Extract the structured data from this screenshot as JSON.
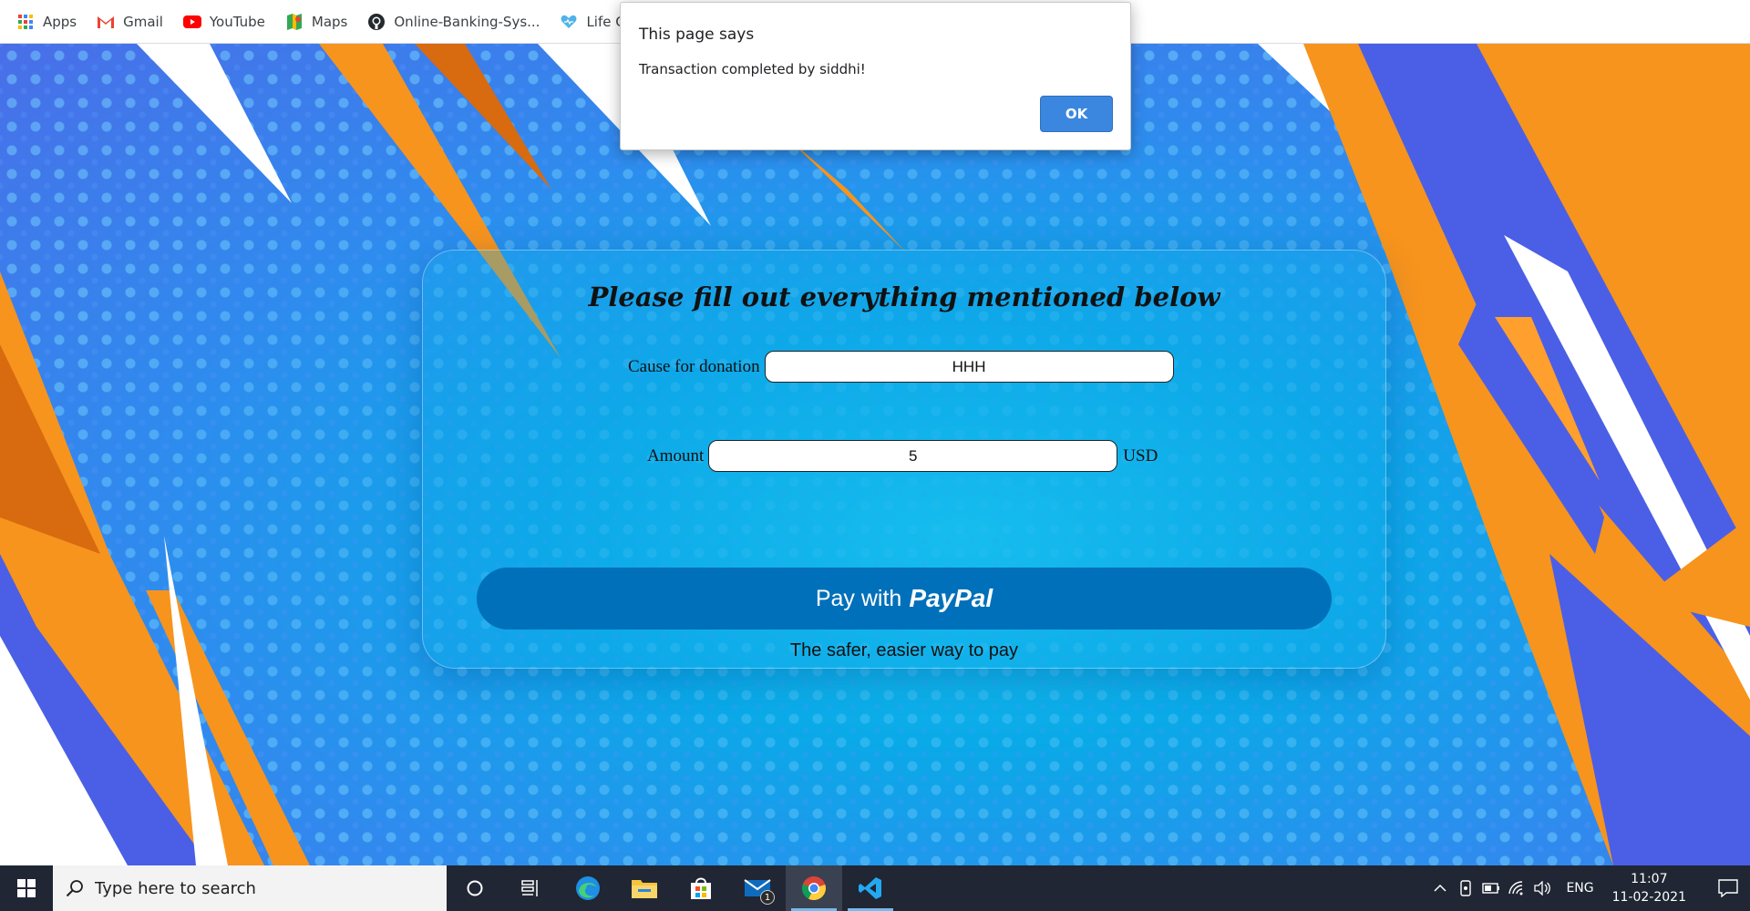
{
  "bookmarks": [
    {
      "label": "Apps",
      "icon": "apps-grid-icon"
    },
    {
      "label": "Gmail",
      "icon": "gmail-icon"
    },
    {
      "label": "YouTube",
      "icon": "youtube-icon"
    },
    {
      "label": "Maps",
      "icon": "maps-icon"
    },
    {
      "label": "Online-Banking-Sys...",
      "icon": "github-icon"
    },
    {
      "label": "Life Care -",
      "icon": "heart-icon"
    }
  ],
  "dialog": {
    "title": "This page says",
    "message": "Transaction completed by siddhi!",
    "ok_label": "OK"
  },
  "form": {
    "title": "Please fill out everything mentioned below",
    "cause_label": "Cause for donation",
    "cause_value": "HHH",
    "amount_label": "Amount",
    "amount_value": "5",
    "currency": "USD",
    "pay_prefix": "Pay with",
    "pay_brand": "PayPal",
    "tagline": "The safer, easier way to pay"
  },
  "colors": {
    "paypal_blue": "#0070ba",
    "dialog_ok": "#3b87e0",
    "accent_orange": "#f7941d",
    "accent_blue": "#4a5fe6",
    "taskbar": "#202633"
  },
  "taskbar": {
    "search_placeholder": "Type here to search",
    "apps": [
      "cortana-icon",
      "task-view-icon",
      "edge-icon",
      "file-explorer-icon",
      "store-icon",
      "mail-icon",
      "chrome-icon",
      "vscode-icon"
    ],
    "mail_badge": "1",
    "language": "ENG",
    "time": "11:07",
    "date": "11-02-2021"
  }
}
